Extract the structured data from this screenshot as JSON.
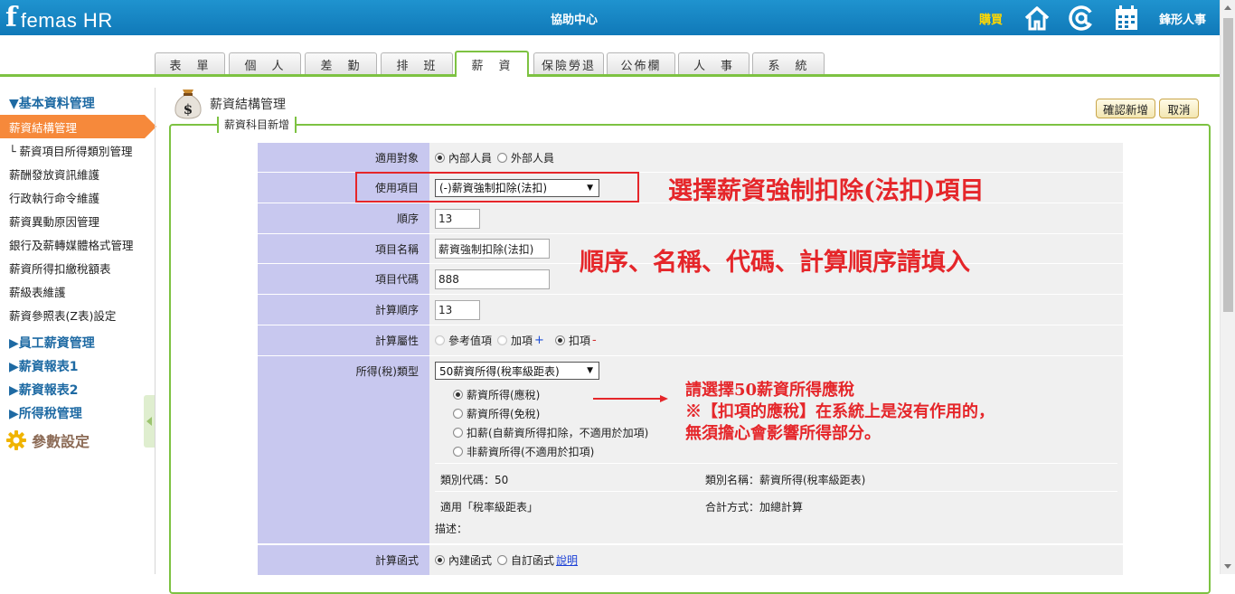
{
  "header": {
    "logo_mark": "f",
    "logo_text": "femas HR",
    "center_title": "協助中心",
    "buy_label": "購買",
    "brand_label": "鋒形人事",
    "icons": [
      "home-icon",
      "at-icon",
      "calendar-icon"
    ]
  },
  "tabs": [
    {
      "label": "表　單"
    },
    {
      "label": "個　人"
    },
    {
      "label": "差　勤"
    },
    {
      "label": "排　班"
    },
    {
      "label": "薪　資",
      "active": true
    },
    {
      "label": "保險勞退"
    },
    {
      "label": "公佈欄"
    },
    {
      "label": "人　事"
    },
    {
      "label": "系　統"
    }
  ],
  "sidebar": {
    "sections": [
      {
        "label": "▼基本資料管理"
      },
      {
        "label": "▶員工薪資管理"
      },
      {
        "label": "▶薪資報表1"
      },
      {
        "label": "▶薪資報表2"
      },
      {
        "label": "▶所得稅管理"
      }
    ],
    "items": [
      {
        "label": "薪資結構管理",
        "active": true
      },
      {
        "label": "└ 薪資項目所得類別管理"
      },
      {
        "label": "薪酬發放資訊維護"
      },
      {
        "label": "行政執行命令維護"
      },
      {
        "label": "薪資異動原因管理"
      },
      {
        "label": "銀行及薪轉媒體格式管理"
      },
      {
        "label": "薪資所得扣繳稅額表"
      },
      {
        "label": "薪級表維護"
      },
      {
        "label": "薪資參照表(Z表)設定"
      }
    ],
    "settings_label": "參數設定"
  },
  "page": {
    "title": "薪資結構管理",
    "legend": "薪資科目新增",
    "confirm_label": "確認新增",
    "cancel_label": "取消"
  },
  "form": {
    "target": {
      "label": "適用對象",
      "options": [
        "內部人員",
        "外部人員"
      ],
      "selected": "內部人員"
    },
    "usage": {
      "label": "使用項目",
      "value": "(-)薪資強制扣除(法扣)"
    },
    "order": {
      "label": "順序",
      "value": "13"
    },
    "item_name": {
      "label": "項目名稱",
      "value": "薪資強制扣除(法扣)"
    },
    "item_code": {
      "label": "項目代碼",
      "value": "888"
    },
    "calc_order": {
      "label": "計算順序",
      "value": "13"
    },
    "calc_attr": {
      "label": "計算屬性",
      "options": [
        "參考值項",
        "加項",
        "扣項"
      ],
      "plus": "+",
      "minus": "-",
      "selected": "扣項"
    },
    "tax_type": {
      "label": "所得(稅)類型",
      "value": "50薪資所得(稅率級距表)",
      "options": [
        "薪資所得(應稅)",
        "薪資所得(免稅)",
        "扣薪(自薪資所得扣除，不適用於加項)",
        "非薪資所得(不適用於扣項)"
      ],
      "selected": "薪資所得(應稅)",
      "category_code": "類別代碼：50",
      "category_name": "類別名稱：薪資所得(稅率級距表)",
      "applies": "適用「稅率級距表」",
      "sum_method": "合計方式：加總計算",
      "description": "描述："
    },
    "calc_func": {
      "label": "計算函式",
      "options": [
        "內建函式",
        "自訂函式"
      ],
      "selected": "內建函式",
      "link": "說明"
    }
  },
  "annotations": {
    "note1": "選擇薪資強制扣除(法扣)項目",
    "note2": "順序、名稱、代碼、計算順序請填入",
    "note3_line1": "請選擇50薪資所得應稅",
    "note3_line2": "※【扣項的應稅】在系統上是沒有作用的，",
    "note3_line3": "無須擔心會影響所得部分。",
    "color": "#e5262a"
  },
  "colors": {
    "header": "#1079b8",
    "accent_green": "#7dc242",
    "sidebar_active": "#f6893b",
    "label_bg": "#c8c8ef"
  }
}
